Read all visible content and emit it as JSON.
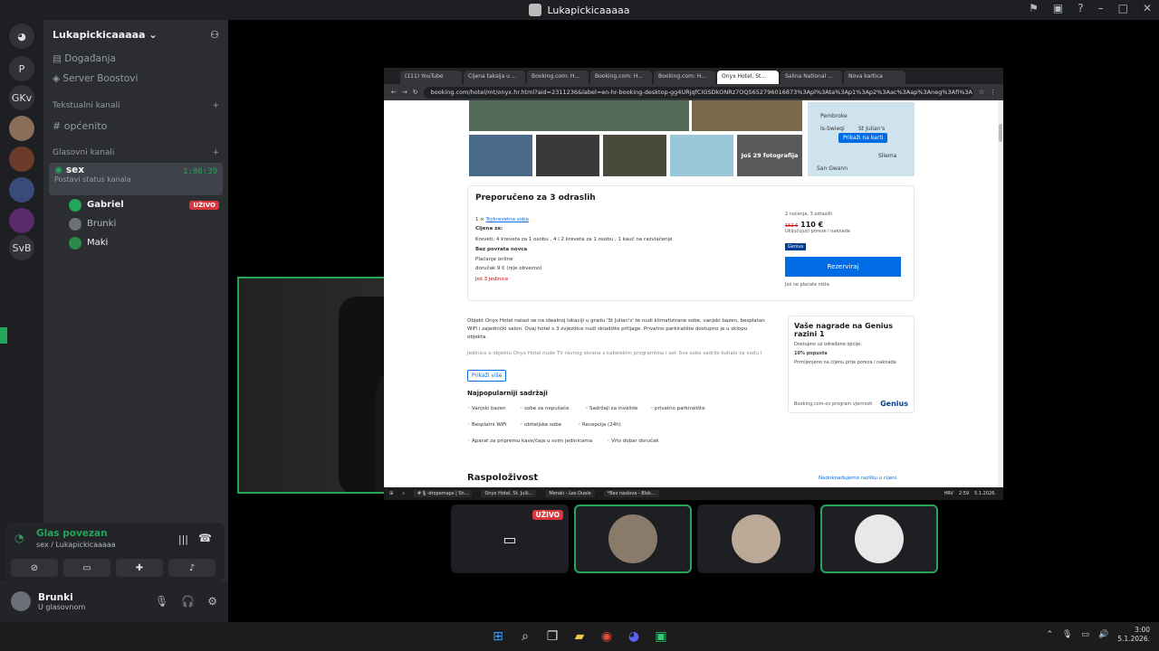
{
  "titlebar": {
    "title": "Lukapickicaaaaa",
    "icons": [
      "inbox-icon",
      "window-icon",
      "help-icon",
      "minimize-icon",
      "maximize-icon",
      "close-icon"
    ]
  },
  "guilds": [
    "P",
    "GKv",
    "SvB"
  ],
  "server": {
    "name": "Lukapickicaaaaa",
    "events": "Događanja",
    "boosts": "Server Boostovi",
    "text_category": "Tekstualni kanali",
    "text_channel": "općenito",
    "voice_category": "Glasovni kanali",
    "voice_channel": {
      "name": "sex",
      "status": "Postavi status kanala",
      "timer": "1:06:39"
    },
    "users": [
      {
        "name": "Gabriel",
        "badge": "UŽIVO"
      },
      {
        "name": "Brunki",
        "badge": ""
      },
      {
        "name": "Maki",
        "badge": ""
      }
    ]
  },
  "connection": {
    "title": "Glas povezan",
    "subtitle": "sex / Lukapickicaaaaa"
  },
  "userbar": {
    "name": "Brunki",
    "status": "U glasovnom"
  },
  "browser": {
    "tabs": [
      "(111) YouTube",
      "Cijena taksija u ...",
      "Booking.com: H...",
      "Booking.com: H...",
      "Booking.com: H...",
      "Onyx Hotel, St...",
      "Salina National ...",
      "Nova kartica"
    ],
    "url": "booking.com/hotel/mt/onyx.hr.html?aid=2311236&label=en-hr-booking-desktop-gg4URjqfCIGSDkONRz7OQS652796016873%3Apl%3Ata%3Ap1%3Ap2%3Aac%3Aap%3Aneg%3Afi%3A",
    "map": {
      "button": "Prikaži na karti",
      "labels": [
        "Pembroke",
        "Is-Swieqi",
        "St Julian's",
        "Sliema",
        "San Gwann"
      ]
    },
    "more_photos": "Još 29 fotografija",
    "recommended": {
      "title": "Preporučeno za 3 odraslih",
      "room_count": "1 ×",
      "room_link": "Trokrevetna soba",
      "price_for": "Cijena za:",
      "beds": "Kreveti: 4 kreveta za 1 osobu , 4 i 2 kreveta za 1 osobu , 1 kauč na razvlačenje",
      "refund": "Bez povrata novca",
      "pay": "Plaćanje online",
      "breakfast": "doručak 9 € (nije obvezno)",
      "left": "Još 3 jedinice",
      "nights": "2 noćenja, 3 odraslih",
      "old_price": "152 €",
      "price": "110 €",
      "tax": "Uključujući poreze i naknade",
      "genius": "Genius",
      "reserve": "Rezerviraj",
      "no_charge": "Još ne plaćate ništa"
    },
    "description": "Objekt Onyx Hotel nalazi se na idealnoj lokaciji u gradu 'St Julian's' te nudi klimatizirane sobe, vanjski bazen, besplatan WiFi i zajednički salon. Ovaj hotel s 3 zvjezdice nudi skladište prtljage. Privatno parkiralište dostupno je u sklopu objekta.",
    "description2": "Jedinice u objektu Onyx Hotel nude TV ravnog ekrana s kabelskim programima i sef. Sve sobe sadrže kuhalo za vodu i",
    "show_more": "Prikaži više",
    "popular": "Najpopularniji sadržaji",
    "facilities": [
      "Vanjski bazen",
      "sobe za nepušače",
      "Sadržaji za invalide",
      "privatno parkiralište",
      "Besplatni WiFi",
      "obiteljske sobe",
      "Recepcija (24h)",
      "Aparat za pripremu kave/čaja u svim jedinicama",
      "Vrlo dobar doručak"
    ],
    "genius_box": {
      "title": "Vaše nagrade na Genius razini 1",
      "sub": "Dostupno uz određene opcije:",
      "discount": "10% popusta",
      "discount_sub": "Primijenjeno na cijenu prije poreza i naknada",
      "foot": "Booking.com-ov program vjernosti",
      "logo": "Genius"
    },
    "availability": "Raspoloživost",
    "compare": "Nadoknađujemo razliku u cijeni",
    "taskbar": [
      "#🎙-dropemaps | Sh...",
      "Onyx Hotel, St. Julii...",
      "Meraki - Les Duele",
      "*Bez naslova - Blok..."
    ],
    "tray": {
      "lang": "HRV",
      "time": "2:59",
      "date": "5.1.2026."
    }
  },
  "stage_tiles": [
    {
      "badge": "UŽIVO"
    },
    {},
    {},
    {}
  ],
  "taskbar": {
    "time": "3:00",
    "date": "5.1.2026."
  }
}
